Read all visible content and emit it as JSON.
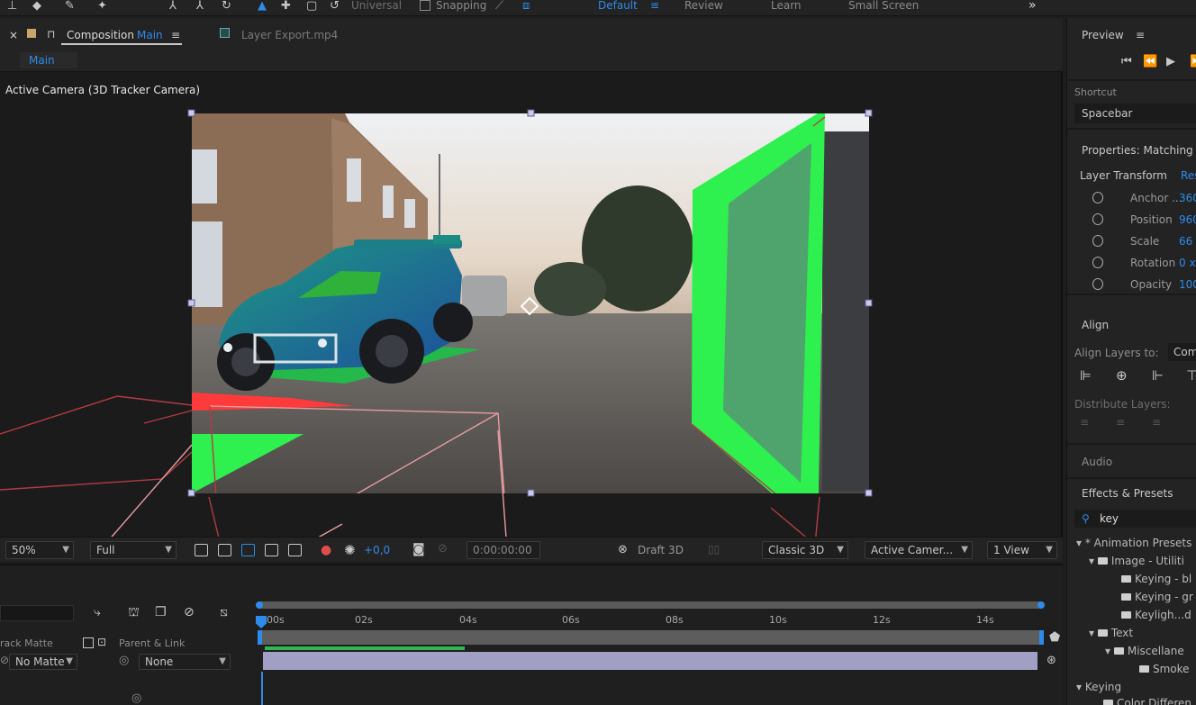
{
  "toolbar": {
    "universal_label": "Universal",
    "snapping_label": "Snapping",
    "workspaces": [
      "Default",
      "Review",
      "Learn",
      "Small Screen"
    ],
    "more": "»"
  },
  "composition": {
    "tab_prefix": "Composition",
    "tab_name": "Main",
    "layer_tab": "Layer  Export.mp4",
    "subtab": "Main",
    "view_label": "Active Camera (3D Tracker Camera)"
  },
  "viewer_bar": {
    "zoom": "50%",
    "resolution": "Full",
    "exposure": "+0,0",
    "timecode": "0:00:00:00",
    "draft3d": "Draft 3D",
    "renderer": "Classic 3D",
    "camera": "Active Camer...",
    "views": "1 View"
  },
  "timeline": {
    "track_matte_header": "rack Matte",
    "parent_header": "Parent & Link",
    "no_matte": "No Matte",
    "parent_value": "None",
    "ruler": [
      "00s",
      "02s",
      "04s",
      "06s",
      "08s",
      "10s",
      "12s",
      "14s"
    ]
  },
  "preview": {
    "title": "Preview",
    "shortcut_label": "Shortcut",
    "shortcut_value": "Spacebar"
  },
  "properties": {
    "title": "Properties: Matching t",
    "layer_transform": "Layer Transform",
    "reset": "Res",
    "rows": [
      {
        "name": "Anchor ...",
        "value": "360"
      },
      {
        "name": "Position",
        "value": "960"
      },
      {
        "name": "Scale",
        "value": "66"
      },
      {
        "name": "Rotation",
        "value": "0 x"
      },
      {
        "name": "Opacity",
        "value": "100"
      }
    ]
  },
  "align": {
    "title": "Align",
    "align_to_label": "Align Layers to:",
    "align_to_value": "Com",
    "distribute": "Distribute Layers:"
  },
  "audio": {
    "title": "Audio"
  },
  "effects": {
    "title": "Effects & Presets",
    "search": "key",
    "tree": [
      {
        "label": "* Animation Presets",
        "level": 0
      },
      {
        "label": "Image - Utiliti",
        "level": 1
      },
      {
        "label": "Keying - bl",
        "level": 2
      },
      {
        "label": "Keying - gr",
        "level": 2
      },
      {
        "label": "Keyligh...d",
        "level": 2
      },
      {
        "label": "Text",
        "level": 1
      },
      {
        "label": "Miscellane",
        "level": 2
      },
      {
        "label": "Smoke",
        "level": 3
      },
      {
        "label": "Keying",
        "level": 0
      },
      {
        "label": "Color Differen",
        "level": 1
      }
    ]
  },
  "colors": {
    "accent": "#2d8ceb",
    "bg": "#1d1d1d",
    "panel": "#232323",
    "green_plane": "#2ef04f",
    "red_plane": "#ff3a3a"
  }
}
